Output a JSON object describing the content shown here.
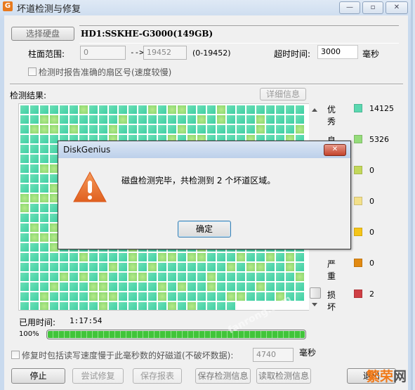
{
  "window": {
    "title": "坏道检测与修复",
    "app_icon": "G",
    "controls": {
      "minimize": "—",
      "maximize": "▫",
      "close": "✕"
    }
  },
  "disk": {
    "select_button": "选择硬盘",
    "name": "HD1:SSKHE-G3000(149GB)"
  },
  "cylinder_range": {
    "label": "柱面范围:",
    "from": "0",
    "arrow": "-->",
    "to": "19452",
    "range_hint": "(0-19452)"
  },
  "timeout": {
    "label": "超时时间:",
    "value": "3000",
    "unit": "毫秒"
  },
  "report_exact_sector": {
    "label": "检测时报告准确的扇区号(速度较慢)",
    "checked": false
  },
  "results": {
    "label": "检测结果:",
    "details_button": "详细信息"
  },
  "legend": [
    {
      "label": "优秀",
      "color": "#5ad8b0",
      "count": "14125"
    },
    {
      "label": "良好",
      "color": "#95dc7a",
      "count": "5326"
    },
    {
      "label": "",
      "color": "#c3d85a",
      "count": "0"
    },
    {
      "label": "",
      "color": "#f3e08a",
      "count": "0"
    },
    {
      "label": "",
      "color": "#f5c518",
      "count": "0"
    },
    {
      "label": "严重",
      "color": "#e28a12",
      "count": "0"
    },
    {
      "label": "损坏",
      "color": "#cf3f45",
      "count": "2"
    }
  ],
  "elapsed": {
    "label": "已用时间:",
    "value": "1:17:54"
  },
  "progress": {
    "label": "100%",
    "value": 1.0
  },
  "repair_option": {
    "label": "修复时包括读写速度慢于此毫秒数的好磁道(不破坏数据):",
    "value": "4740",
    "unit": "毫秒",
    "checked": false
  },
  "buttons": {
    "stop": "停止",
    "try_repair": "尝试修复",
    "save_report": "保存报表",
    "save_info": "保存检测信息",
    "load_info": "读取检测信息",
    "exit": "退出"
  },
  "dialog": {
    "title": "DiskGenius",
    "message": "磁盘检测完毕，共检测到 2 个坏道区域。",
    "ok": "确定",
    "close": "✕"
  },
  "watermarks": {
    "diagonal": "fanrong.com",
    "corner_main": "繁荣",
    "corner_tail": "网"
  }
}
